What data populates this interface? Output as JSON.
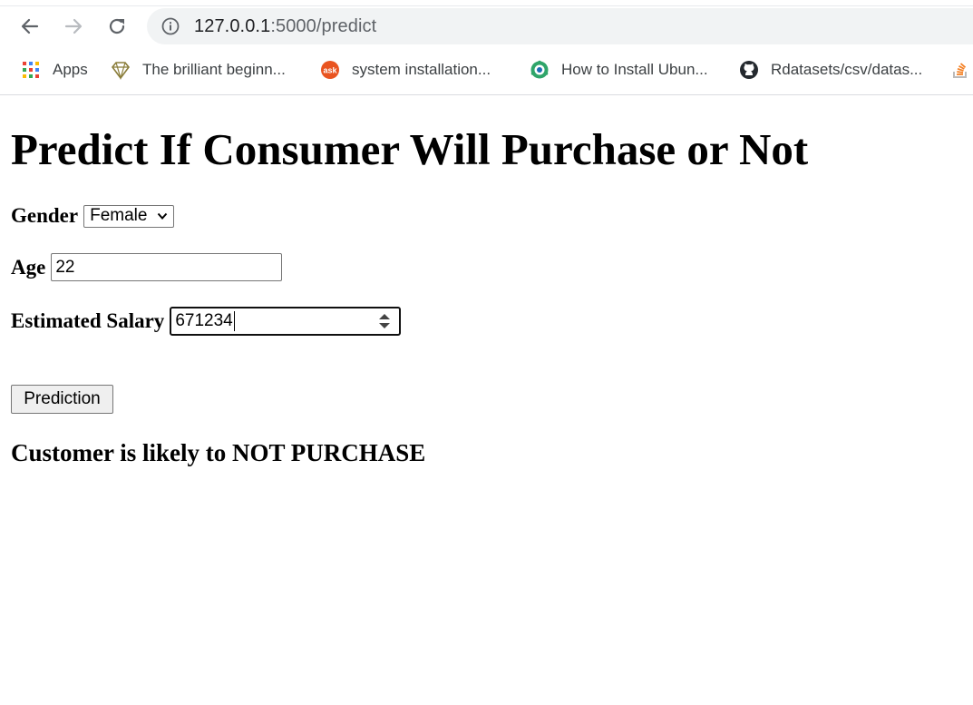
{
  "browser": {
    "url_host": "127.0.0.1",
    "url_rest": ":5000/predict",
    "bookmarks": [
      {
        "label": "Apps",
        "icon": "apps-grid-icon"
      },
      {
        "label": "The brilliant beginn...",
        "icon": "diamond-icon"
      },
      {
        "label": "system installation...",
        "icon": "ask-icon"
      },
      {
        "label": "How to Install Ubun...",
        "icon": "ubuntu-gear-icon"
      },
      {
        "label": "Rdatasets/csv/datas...",
        "icon": "github-icon"
      }
    ]
  },
  "page": {
    "title": "Predict If Consumer Will Purchase or Not",
    "form": {
      "gender_label": "Gender",
      "gender_value": "Female",
      "age_label": "Age",
      "age_value": "22",
      "salary_label": "Estimated Salary",
      "salary_value": "671234",
      "submit_label": "Prediction"
    },
    "result": "Customer is likely to NOT PURCHASE"
  }
}
